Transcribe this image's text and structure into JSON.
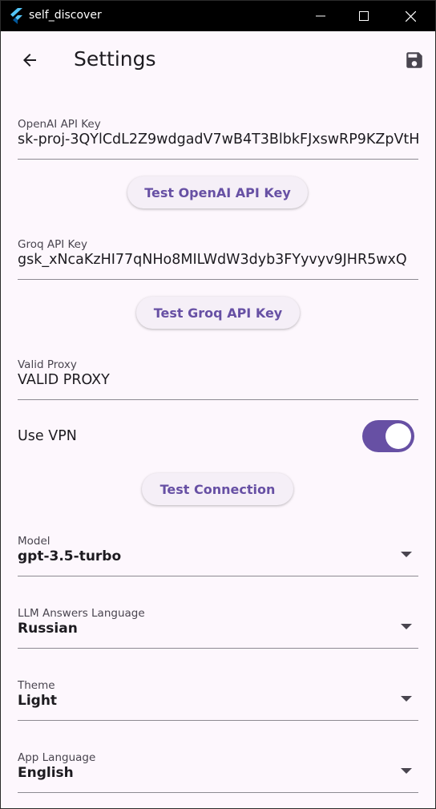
{
  "window": {
    "title": "self_discover"
  },
  "appbar": {
    "title": "Settings"
  },
  "openai": {
    "label": "OpenAI API Key",
    "value": "sk-proj-3QYlCdL2Z9wdgadV7wB4T3BlbkFJxswRP9KZpVtH",
    "button": "Test OpenAI API Key"
  },
  "groq": {
    "label": "Groq API Key",
    "value": "gsk_xNcaKzHI77qNHo8MILWdW3dyb3FYyvyv9JHR5wxQ",
    "button": "Test Groq API Key"
  },
  "proxy": {
    "label": "Valid Proxy",
    "value": "VALID PROXY"
  },
  "vpn": {
    "label": "Use VPN",
    "enabled": true
  },
  "connection": {
    "button": "Test Connection"
  },
  "model": {
    "label": "Model",
    "value": "gpt-3.5-turbo"
  },
  "llm_language": {
    "label": "LLM Answers Language",
    "value": "Russian"
  },
  "theme": {
    "label": "Theme",
    "value": "Light"
  },
  "app_language": {
    "label": "App Language",
    "value": "English"
  },
  "colors": {
    "accent": "#6750a4",
    "background": "#fdf7fd",
    "titlebar": "#000000"
  },
  "icons": [
    "flutter-logo-icon",
    "minimize-icon",
    "maximize-icon",
    "close-icon",
    "arrow-back-icon",
    "save-icon",
    "dropdown-arrow-icon"
  ]
}
